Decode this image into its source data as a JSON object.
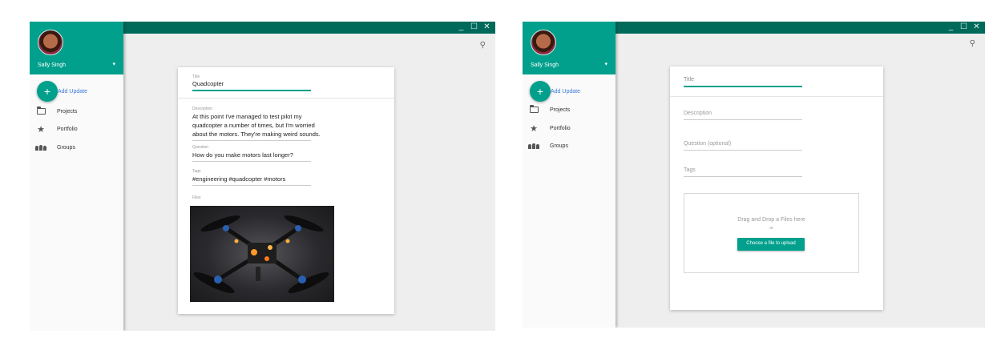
{
  "window_controls": {
    "minimize": "_",
    "maximize": "☐",
    "close": "✕"
  },
  "user": {
    "name": "Sally Singh",
    "caret": "▾"
  },
  "sidebar": {
    "add_update_label": "Add Update",
    "fab_symbol": "+",
    "items": [
      {
        "label": "Projects",
        "icon": "folder-icon"
      },
      {
        "label": "Portfolio",
        "icon": "star-icon"
      },
      {
        "label": "Groups",
        "icon": "groups-icon"
      }
    ]
  },
  "search_symbol": "⚲",
  "left_card": {
    "title_label": "Title",
    "title_value": "Quadcopter",
    "description_label": "Description",
    "description_lines": [
      "At this point I've managed to test pilot my",
      "quadcopter a number of times, but I'm worried",
      "about the motors. They're making weird sounds."
    ],
    "question_label": "Question",
    "question_value": "How do you make motors last longer?",
    "tags_label": "Tags",
    "tags_value": "#engineering #quadcopter #motors",
    "files_label": "Files"
  },
  "right_card": {
    "title_placeholder": "Title",
    "description_placeholder": "Description",
    "question_placeholder": "Question (optional)",
    "tags_placeholder": "Tags",
    "drop_text": "Drag and Drop a Files here",
    "or_text": "or",
    "upload_button": "Choose a file to upload"
  },
  "colors": {
    "accent": "#00a08c",
    "titlebar": "#006a5a",
    "link": "#3a7bd5"
  }
}
